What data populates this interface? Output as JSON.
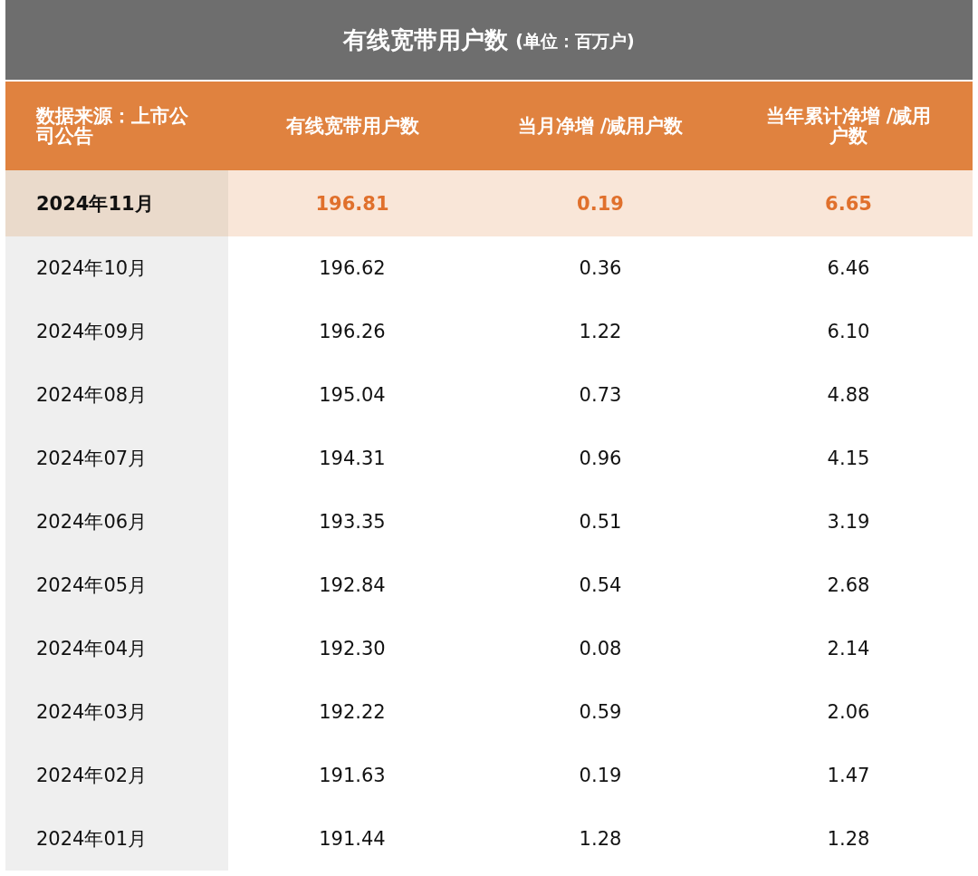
{
  "title": {
    "text": "有线宽带用户数",
    "unit": "(单位：百万户)"
  },
  "table": {
    "columns": [
      "数据来源：上市公司公告",
      "有线宽带用户数",
      "当月净增 /减用户数",
      "当年累计净增 /减用户数"
    ],
    "rows": [
      {
        "month": "2024年11月",
        "values": [
          "196.81",
          "0.19",
          "6.65"
        ],
        "highlighted": true
      },
      {
        "month": "2024年10月",
        "values": [
          "196.62",
          "0.36",
          "6.46"
        ],
        "highlighted": false
      },
      {
        "month": "2024年09月",
        "values": [
          "196.26",
          "1.22",
          "6.10"
        ],
        "highlighted": false
      },
      {
        "month": "2024年08月",
        "values": [
          "195.04",
          "0.73",
          "4.88"
        ],
        "highlighted": false
      },
      {
        "month": "2024年07月",
        "values": [
          "194.31",
          "0.96",
          "4.15"
        ],
        "highlighted": false
      },
      {
        "month": "2024年06月",
        "values": [
          "193.35",
          "0.51",
          "3.19"
        ],
        "highlighted": false
      },
      {
        "month": "2024年05月",
        "values": [
          "192.84",
          "0.54",
          "2.68"
        ],
        "highlighted": false
      },
      {
        "month": "2024年04月",
        "values": [
          "192.30",
          "0.08",
          "2.14"
        ],
        "highlighted": false
      },
      {
        "month": "2024年03月",
        "values": [
          "192.22",
          "0.59",
          "2.06"
        ],
        "highlighted": false
      },
      {
        "month": "2024年02月",
        "values": [
          "191.63",
          "0.19",
          "1.47"
        ],
        "highlighted": false
      },
      {
        "month": "2024年01月",
        "values": [
          "191.44",
          "1.28",
          "1.28"
        ],
        "highlighted": false
      }
    ]
  }
}
